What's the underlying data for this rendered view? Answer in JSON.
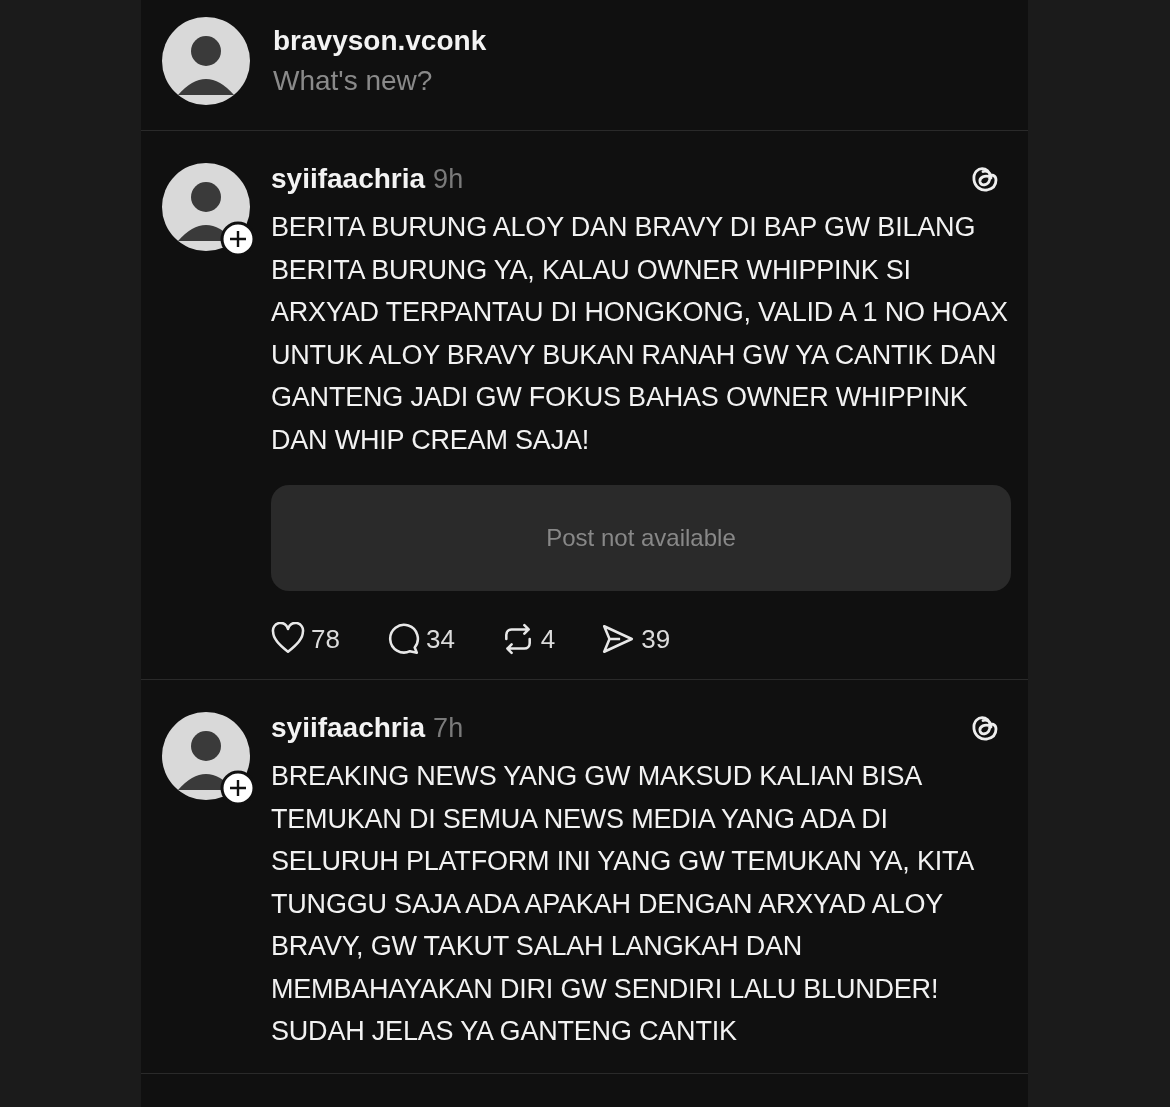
{
  "composer": {
    "username": "bravyson.vconk",
    "placeholder": "What's new?"
  },
  "posts": [
    {
      "username": "syiifaachria",
      "time": "9h",
      "body": "BERITA BURUNG ALOY DAN BRAVY DI BAP GW BILANG BERITA BURUNG YA, KALAU OWNER WHIPPINK SI ARXYAD TERPANTAU DI HONGKONG, VALID A 1 NO HOAX UNTUK ALOY BRAVY BUKAN RANAH GW YA CANTIK DAN GANTENG JADI GW FOKUS BAHAS OWNER WHIPPINK DAN WHIP CREAM SAJA!",
      "quote": "Post not available",
      "actions": [
        {
          "kind": "like",
          "count": "78"
        },
        {
          "kind": "reply",
          "count": "34"
        },
        {
          "kind": "repost",
          "count": "4"
        },
        {
          "kind": "share",
          "count": "39"
        }
      ]
    },
    {
      "username": "syiifaachria",
      "time": "7h",
      "body": "BREAKING NEWS YANG GW MAKSUD KALIAN BISA TEMUKAN DI SEMUA NEWS MEDIA YANG ADA DI SELURUH PLATFORM INI YANG GW TEMUKAN YA, KITA TUNGGU SAJA ADA APAKAH DENGAN ARXYAD ALOY BRAVY, GW TAKUT SALAH LANGKAH DAN MEMBAHAYAKAN DIRI GW SENDIRI LALU BLUNDER! SUDAH JELAS YA GANTENG CANTIK"
    }
  ]
}
